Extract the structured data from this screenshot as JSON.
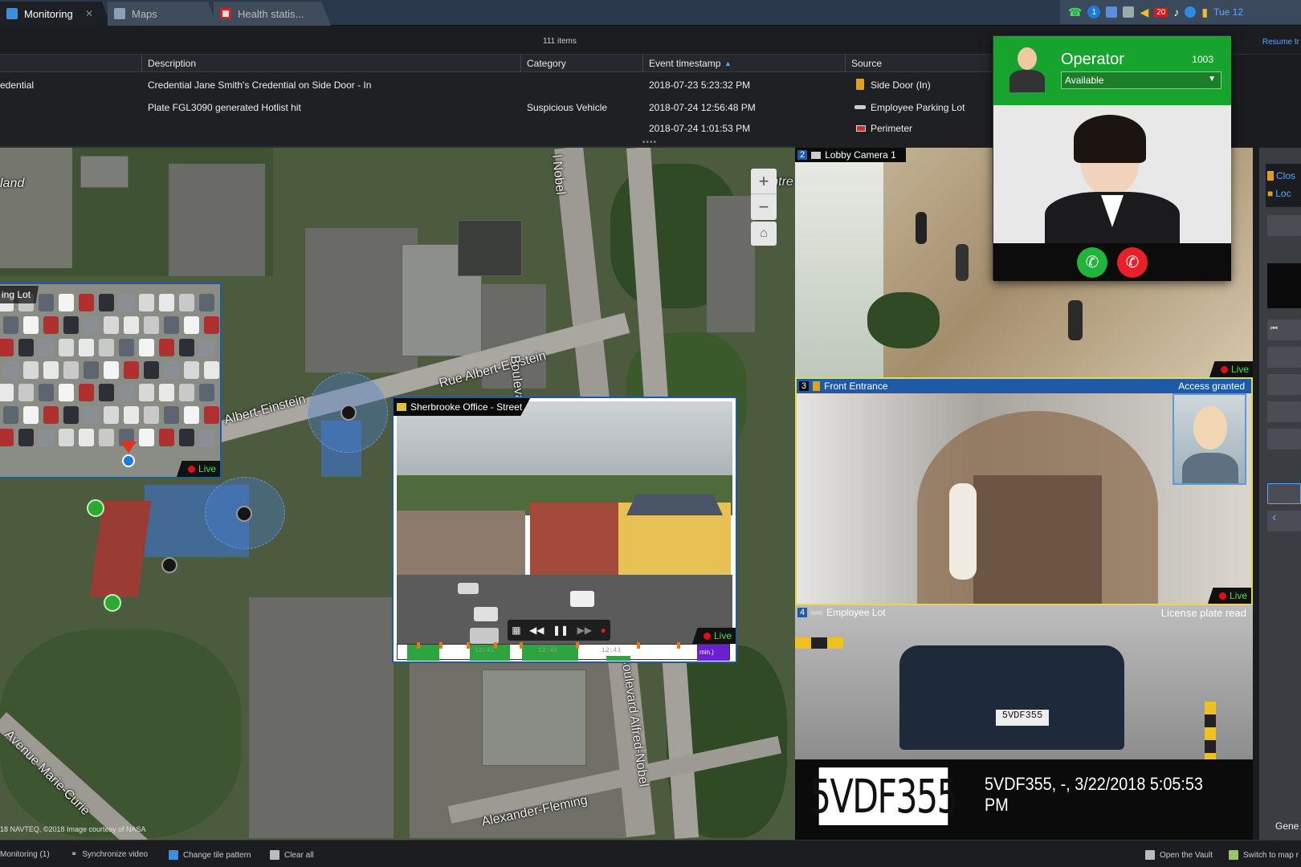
{
  "tabs": [
    {
      "label": "Monitoring",
      "icon": "monitoring-icon",
      "active": true
    },
    {
      "label": "Maps",
      "icon": "maps-icon"
    },
    {
      "label": "Health statis...",
      "icon": "health-icon"
    }
  ],
  "tray": {
    "badge": "20",
    "clock": "Tue 12",
    "call_badge": "1"
  },
  "events": {
    "item_count": "111 items",
    "resume": "Resume tr",
    "columns": [
      "Description",
      "Category",
      "Event timestamp",
      "Source"
    ],
    "first_col_header": "",
    "rows": [
      {
        "type": "edential",
        "description": "Credential Jane Smith's Credential on Side Door - In",
        "category": "",
        "timestamp": "2018-07-23 5:23:32 PM",
        "source": "Side Door (In)",
        "source_icon": "door-icon"
      },
      {
        "type": "",
        "description": "Plate FGL3090 generated Hotlist hit",
        "category": "Suspicious Vehicle",
        "timestamp": "2018-07-24 12:56:48 PM",
        "source": "Employee Parking Lot",
        "source_icon": "lpr-camera-icon"
      },
      {
        "type": "",
        "description": "",
        "category": "",
        "timestamp": "2018-07-24 1:01:53 PM",
        "source": "Perimeter",
        "source_icon": "perimeter-icon"
      }
    ]
  },
  "map": {
    "labels": [
      "land",
      "Rue Albert-Einstein",
      "Albert-Einstein",
      "Boulevard Alfre",
      "l Nobel",
      "Montre",
      "Boulevard Alfred-Nobel",
      "Avenue Marie-Curie",
      "Alexander-Fleming"
    ],
    "credit": "18 NAVTEQ, ©2018 Image courtesy of NASA",
    "parking_tile": {
      "title": "ing Lot",
      "live": "Live"
    },
    "street_tile": {
      "title": "Sherbrooke Office - Street",
      "live": "Live",
      "times": [
        "12:41",
        "12:42",
        "12:43"
      ],
      "tl_end": "min.)"
    }
  },
  "cameras": [
    {
      "num": "2",
      "title": "Lobby Camera 1",
      "live": "Live"
    },
    {
      "num": "3",
      "title": "Front Entrance",
      "caption": "Access granted",
      "live": "Live"
    },
    {
      "num": "4",
      "title": "Employee Lot",
      "caption": "License plate read",
      "plate": "5VDF355",
      "plate_small": "5VDF355",
      "plate_read": "5VDF355, -, 3/22/2018 5:05:53 PM"
    }
  ],
  "operator": {
    "title": "Operator",
    "number": "1003",
    "status": "Available"
  },
  "right_panel": {
    "items": [
      "Clos",
      "Loc"
    ],
    "footer": "Gene"
  },
  "bottombar": {
    "left": [
      "Monitoring (1)",
      "Synchronize video",
      "Change tile pattern",
      "Clear all"
    ],
    "right": [
      "Open the Vault",
      "Switch to map r"
    ]
  },
  "colors": {
    "accent": "#1f5aa8",
    "live_green": "#3ee05a",
    "call_green": "#16a32e",
    "reject_red": "#e8202a"
  }
}
